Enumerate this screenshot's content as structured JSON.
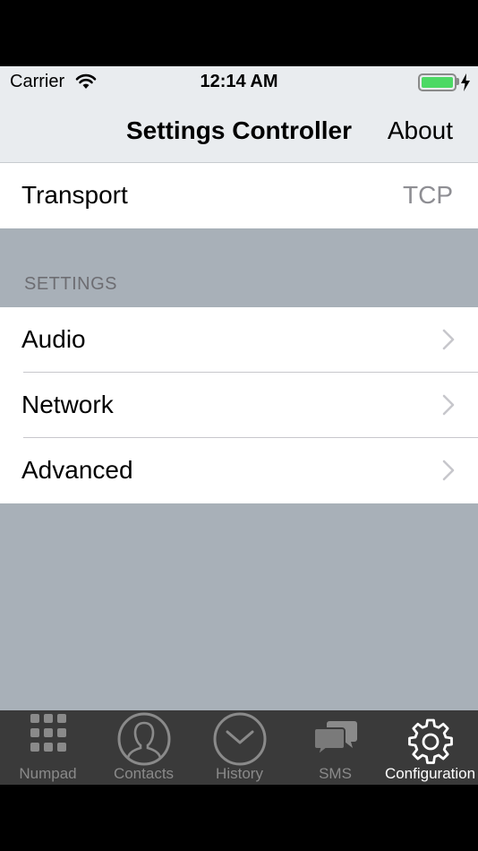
{
  "status_bar": {
    "carrier": "Carrier",
    "time": "12:14 AM",
    "battery_level": 1.0,
    "charging": true
  },
  "nav": {
    "title": "Settings Controller",
    "right_button": "About"
  },
  "transport": {
    "label": "Transport",
    "value": "TCP"
  },
  "settings_section": {
    "header": "SETTINGS",
    "items": [
      {
        "label": "Audio",
        "icon": "chevron-right-icon"
      },
      {
        "label": "Network",
        "icon": "chevron-right-icon"
      },
      {
        "label": "Advanced",
        "icon": "chevron-right-icon"
      }
    ]
  },
  "tab_bar": {
    "tabs": [
      {
        "label": "Numpad",
        "icon": "numpad-icon",
        "active": false
      },
      {
        "label": "Contacts",
        "icon": "contacts-icon",
        "active": false
      },
      {
        "label": "History",
        "icon": "history-icon",
        "active": false
      },
      {
        "label": "SMS",
        "icon": "sms-icon",
        "active": false
      },
      {
        "label": "Configuration",
        "icon": "gear-icon",
        "active": true
      }
    ]
  },
  "colors": {
    "bar_background": "#e9ecef",
    "grouped_background": "#a8b0b8",
    "tab_bar_background": "#3a3a3a",
    "battery_green": "#4cd964"
  }
}
